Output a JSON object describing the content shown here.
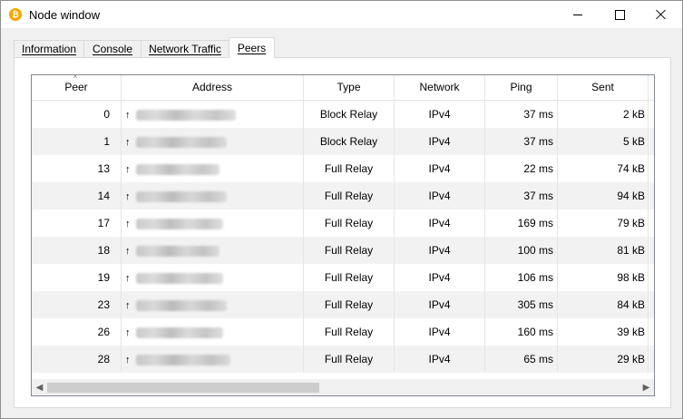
{
  "window": {
    "title": "Node window",
    "icon": "bitcoin-icon"
  },
  "tabs": [
    {
      "label": "Information"
    },
    {
      "label": "Console"
    },
    {
      "label": "Network Traffic"
    },
    {
      "label": "Peers",
      "active": true
    }
  ],
  "table": {
    "columns": [
      "Peer",
      "Address",
      "Type",
      "Network",
      "Ping",
      "Sent"
    ],
    "sort_column": "Peer",
    "rows": [
      {
        "peer": "0",
        "direction": "↑",
        "type": "Block Relay",
        "network": "IPv4",
        "ping": "37 ms",
        "sent": "2 kB"
      },
      {
        "peer": "1",
        "direction": "↑",
        "type": "Block Relay",
        "network": "IPv4",
        "ping": "37 ms",
        "sent": "5 kB"
      },
      {
        "peer": "13",
        "direction": "↑",
        "type": "Full Relay",
        "network": "IPv4",
        "ping": "22 ms",
        "sent": "74 kB"
      },
      {
        "peer": "14",
        "direction": "↑",
        "type": "Full Relay",
        "network": "IPv4",
        "ping": "37 ms",
        "sent": "94 kB"
      },
      {
        "peer": "17",
        "direction": "↑",
        "type": "Full Relay",
        "network": "IPv4",
        "ping": "169 ms",
        "sent": "79 kB"
      },
      {
        "peer": "18",
        "direction": "↑",
        "type": "Full Relay",
        "network": "IPv4",
        "ping": "100 ms",
        "sent": "81 kB"
      },
      {
        "peer": "19",
        "direction": "↑",
        "type": "Full Relay",
        "network": "IPv4",
        "ping": "106 ms",
        "sent": "98 kB"
      },
      {
        "peer": "23",
        "direction": "↑",
        "type": "Full Relay",
        "network": "IPv4",
        "ping": "305 ms",
        "sent": "84 kB"
      },
      {
        "peer": "26",
        "direction": "↑",
        "type": "Full Relay",
        "network": "IPv4",
        "ping": "160 ms",
        "sent": "39 kB"
      },
      {
        "peer": "28",
        "direction": "↑",
        "type": "Full Relay",
        "network": "IPv4",
        "ping": "65 ms",
        "sent": "29 kB"
      }
    ]
  },
  "colors": {
    "row_alt": "#f2f2f2",
    "app_icon": "#f2a900"
  }
}
